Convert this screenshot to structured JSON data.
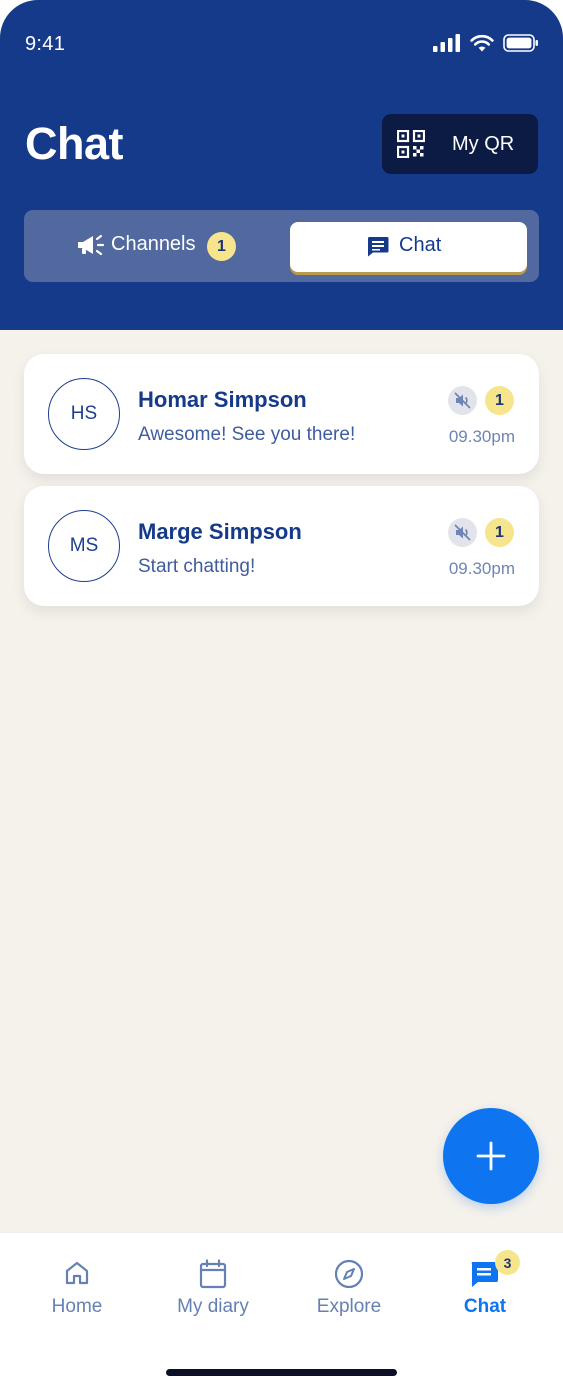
{
  "status_bar": {
    "time": "9:41"
  },
  "header": {
    "title": "Chat",
    "qr_button": {
      "label": "My QR",
      "icon": "qr-code-icon"
    }
  },
  "tabs": {
    "channels": {
      "label": "Channels",
      "badge": "1",
      "icon": "megaphone-icon"
    },
    "chat": {
      "label": "Chat",
      "icon": "chat-bubble-icon",
      "active": true
    }
  },
  "chats": [
    {
      "initials": "HS",
      "name": "Homar Simpson",
      "message": "Awesome! See you there!",
      "time": "09.30pm",
      "unread": "1",
      "muted": true
    },
    {
      "initials": "MS",
      "name": "Marge Simpson",
      "message": "Start chatting!",
      "time": "09.30pm",
      "unread": "1",
      "muted": true
    }
  ],
  "fab": {
    "icon": "plus-icon"
  },
  "bottom_nav": [
    {
      "label": "Home",
      "icon": "home-icon"
    },
    {
      "label": "My diary",
      "icon": "calendar-icon"
    },
    {
      "label": "Explore",
      "icon": "compass-icon"
    },
    {
      "label": "Chat",
      "icon": "chat-icon",
      "active": true,
      "badge": "3"
    }
  ],
  "colors": {
    "header_bg": "#163A8A",
    "accent_blue": "#0E74F0",
    "badge_yellow": "#F7E58E",
    "background": "#F5F1EB"
  }
}
